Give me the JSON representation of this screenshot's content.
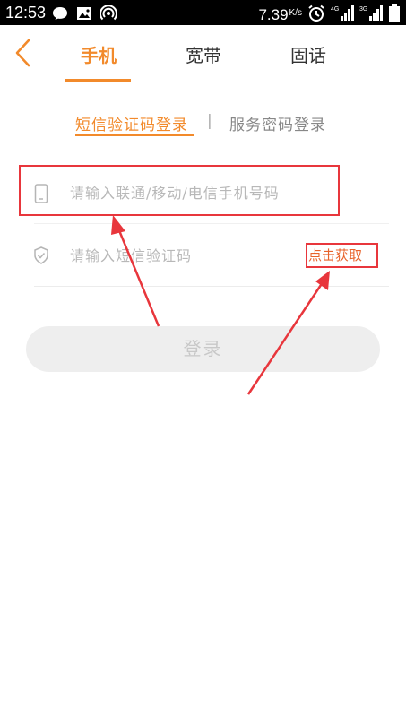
{
  "status_bar": {
    "time": "12:53",
    "speed": "7.39",
    "speed_unit": "K/s",
    "left_icons": [
      "chat-bubble-icon",
      "image-notification-icon",
      "hotspot-icon"
    ],
    "right_icons": [
      "alarm-icon",
      "signal-4g-icon",
      "signal-3g-icon",
      "battery-icon"
    ]
  },
  "header": {
    "back_icon": "chevron-left-icon",
    "tabs": [
      {
        "label": "手机",
        "active": true
      },
      {
        "label": "宽带",
        "active": false
      },
      {
        "label": "固话",
        "active": false
      }
    ]
  },
  "login_type": {
    "sms_label": "短信验证码登录",
    "separator": "|",
    "password_label": "服务密码登录"
  },
  "phone_field": {
    "icon": "phone-icon",
    "placeholder": "请输入联通/移动/电信手机号码",
    "value": ""
  },
  "code_field": {
    "icon": "shield-check-icon",
    "placeholder": "请输入短信验证码",
    "value": "",
    "get_code_label": "点击获取"
  },
  "login_button": {
    "label": "登录"
  },
  "colors": {
    "accent": "#f28a2b",
    "annotation_red": "#e8363c",
    "button_bg": "#eeeeee"
  }
}
